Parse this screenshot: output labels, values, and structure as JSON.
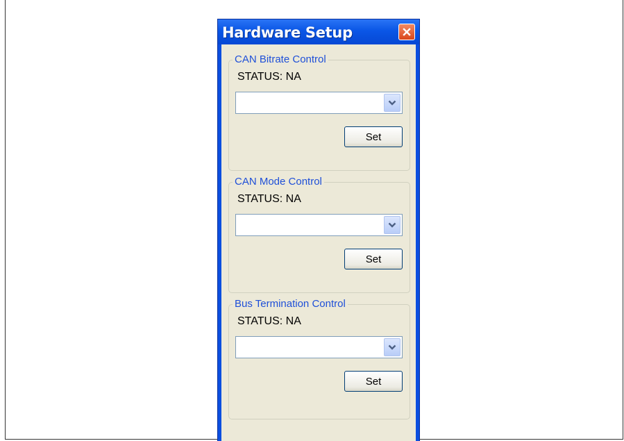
{
  "window": {
    "title": "Hardware Setup",
    "close_icon": "close-icon"
  },
  "groups": [
    {
      "legend": "CAN Bitrate Control",
      "status": "STATUS: NA",
      "select_value": "",
      "set_label": "Set"
    },
    {
      "legend": "CAN Mode Control",
      "status": "STATUS: NA",
      "select_value": "",
      "set_label": "Set"
    },
    {
      "legend": "Bus Termination Control",
      "status": "STATUS: NA",
      "select_value": "",
      "set_label": "Set"
    }
  ],
  "colors": {
    "titlebar": "#0a56e6",
    "client": "#ece9d8",
    "legend_text": "#1e4fd8",
    "close_button": "#d9461a"
  }
}
